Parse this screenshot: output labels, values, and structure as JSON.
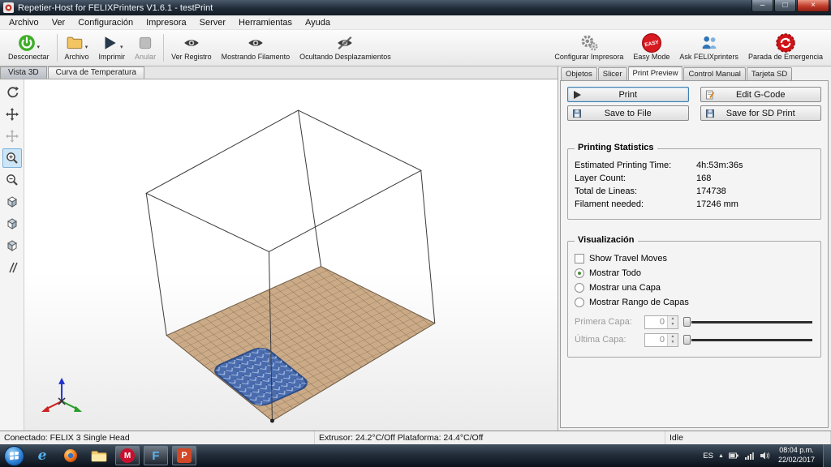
{
  "window": {
    "title": "Repetier-Host for FELIXPrinters V1.6.1 - testPrint",
    "controls": {
      "minimize": "–",
      "maximize": "□",
      "close": "×"
    }
  },
  "menu": {
    "items": [
      "Archivo",
      "Ver",
      "Configuración",
      "Impresora",
      "Server",
      "Herramientas",
      "Ayuda"
    ]
  },
  "toolbar": {
    "left": [
      {
        "label": "Desconectar",
        "icon": "power-connect-icon",
        "dropdown": true
      },
      {
        "label": "Archivo",
        "icon": "folder-icon",
        "dropdown": true
      },
      {
        "label": "Imprimir",
        "icon": "play-icon",
        "dropdown": true
      },
      {
        "label": "Anular",
        "icon": "stop-icon",
        "disabled": true
      },
      {
        "label": "Ver Registro",
        "icon": "eye-icon"
      },
      {
        "label": "Mostrando Filamento",
        "icon": "eye-icon"
      },
      {
        "label": "Ocultando Desplazamientos",
        "icon": "eye-slash-icon"
      }
    ],
    "right": [
      {
        "label": "Configurar Impresora",
        "icon": "gears-icon"
      },
      {
        "label": "Easy Mode",
        "icon": "easy-badge-icon",
        "badge": "EASY"
      },
      {
        "label": "Ask FELIXprinters",
        "icon": "people-icon"
      },
      {
        "label": "Parada de Emergencia",
        "icon": "emergency-stop-icon"
      }
    ]
  },
  "ui_glyphs": {
    "dropdown": "▾",
    "spin_up": "▲",
    "spin_down": "▼",
    "tray_expand": "▲"
  },
  "view_tabs": {
    "vista3d": "Vista 3D",
    "temp_curve": "Curva de Temperatura"
  },
  "right_panel": {
    "tabs": [
      "Objetos",
      "Slicer",
      "Print Preview",
      "Control Manual",
      "Tarjeta SD"
    ],
    "active_tab": "Print Preview",
    "buttons": {
      "print": "Print",
      "edit_gcode": "Edit G-Code",
      "save_file": "Save to File",
      "save_sd": "Save for SD Print"
    },
    "stats": {
      "title": "Printing Statistics",
      "rows": [
        {
          "label": "Estimated Printing Time:",
          "value": "4h:53m:36s"
        },
        {
          "label": "Layer Count:",
          "value": "168"
        },
        {
          "label": "Total de Lineas:",
          "value": "174738"
        },
        {
          "label": "Filament needed:",
          "value": "17246 mm"
        }
      ]
    },
    "visualization": {
      "title": "Visualización",
      "show_travel": "Show Travel Moves",
      "radios": [
        {
          "label": "Mostrar Todo",
          "selected": true
        },
        {
          "label": "Mostrar una Capa",
          "selected": false
        },
        {
          "label": "Mostrar Rango de Capas",
          "selected": false
        }
      ],
      "first_layer": {
        "label": "Primera Capa:",
        "value": "0"
      },
      "last_layer": {
        "label": "Última Capa:",
        "value": "0"
      }
    }
  },
  "statusbar": {
    "connection": "Conectado: FELIX 3 Single Head",
    "temps": "Extrusor: 24.2°C/Off Plataforma: 24.4°C/Off",
    "state": "Idle"
  },
  "taskbar": {
    "icons": {
      "ie_letter": "e",
      "makerbot_letter": "M",
      "repetier_letter": "F",
      "powerpoint_letter": "P"
    },
    "tray": {
      "language": "ES",
      "time": "08:04 p.m.",
      "date": "22/02/2017"
    }
  },
  "colors": {
    "bed_tan": "#cbaa87",
    "object_blue": "#4a6cae",
    "easy_red": "#d71920",
    "emergency_red": "#cf1317",
    "connect_green": "#3fae2a"
  }
}
